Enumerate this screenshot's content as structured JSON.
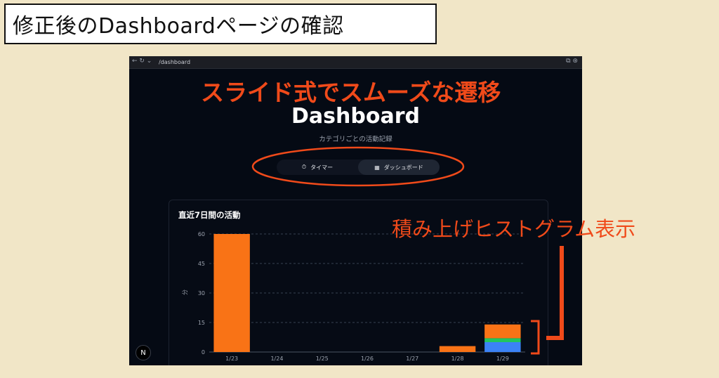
{
  "header": {
    "title": "修正後のDashboardページの確認"
  },
  "browser": {
    "nav_icons": "← ↻ ⌄",
    "url": "/dashboard",
    "right_icons": "⧉ ⊛"
  },
  "page": {
    "title": "Dashboard",
    "subtitle": "カテゴリごとの活動記録",
    "tabs": [
      {
        "icon": "⏱",
        "label": "タイマー"
      },
      {
        "icon": "▦",
        "label": "ダッシュボード"
      }
    ],
    "badge": "N"
  },
  "annotations": {
    "transition": "スライド式でスムーズな遷移",
    "histogram": "積み上げヒストグラム表示"
  },
  "colors": {
    "orange": "#f97316",
    "green": "#22c55e",
    "blue": "#3b82f6",
    "annotation": "#f04a1a"
  },
  "card": {
    "title": "直近7日間の活動"
  },
  "chart_data": {
    "type": "bar",
    "stacked": true,
    "categories": [
      "1/23",
      "1/24",
      "1/25",
      "1/26",
      "1/27",
      "1/28",
      "1/29"
    ],
    "series": [
      {
        "values": [
          0,
          0,
          0,
          0,
          0,
          0,
          5
        ],
        "color": "#3b82f6"
      },
      {
        "values": [
          0,
          0,
          0,
          0,
          0,
          0,
          2
        ],
        "color": "#22c55e"
      },
      {
        "values": [
          60,
          0,
          0,
          0,
          0,
          3,
          7
        ],
        "color": "#f97316"
      }
    ],
    "ylabel": "分",
    "yticks": [
      "0",
      "15",
      "30",
      "45",
      "60"
    ],
    "ylim": [
      0,
      60
    ],
    "grid": true
  }
}
